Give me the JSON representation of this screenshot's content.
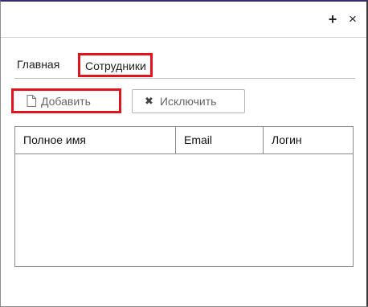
{
  "window": {
    "add_glyph": "+",
    "close_glyph": "×"
  },
  "tabs": [
    {
      "label": "Главная"
    },
    {
      "label": "Сотрудники"
    }
  ],
  "toolbar": {
    "add_label": "Добавить",
    "add_icon": "document-icon",
    "exclude_label": "Исключить",
    "exclude_icon": "x-icon"
  },
  "table": {
    "columns": [
      "Полное имя",
      "Email",
      "Логин"
    ],
    "rows": []
  },
  "colors": {
    "highlight": "#e0141c",
    "window_top_border": "#3a2b6e"
  }
}
